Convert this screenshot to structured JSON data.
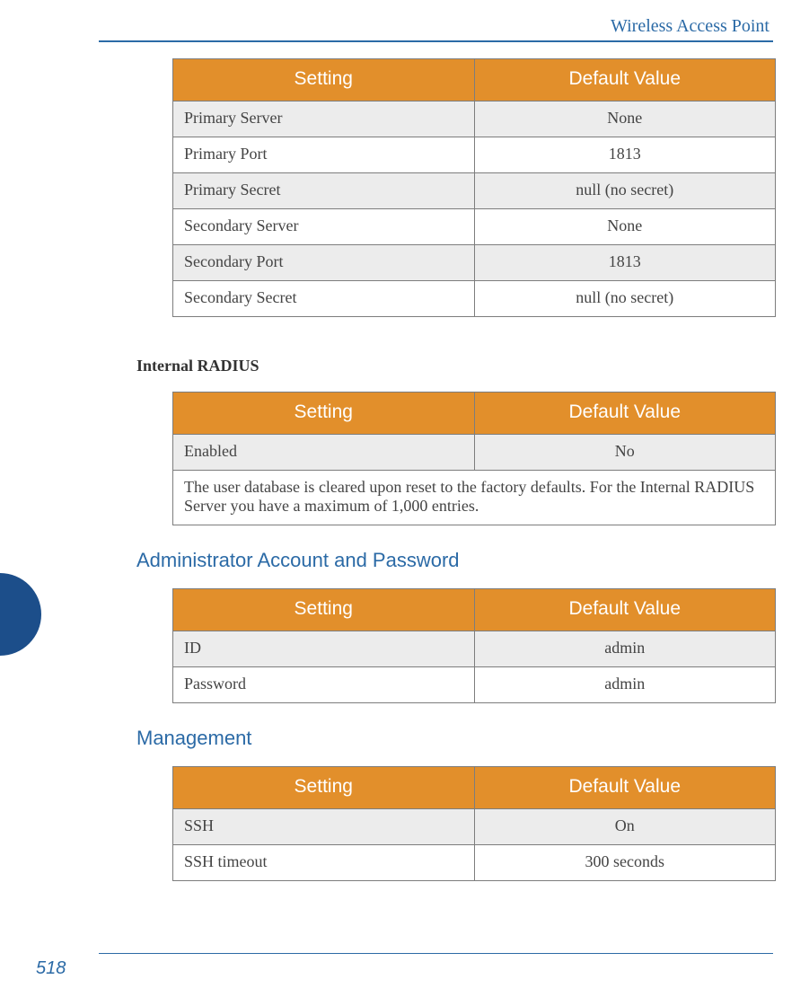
{
  "header": {
    "section_label": "Wireless Access Point"
  },
  "tables": {
    "radius_primary_secondary": {
      "columns": [
        "Setting",
        "Default Value"
      ],
      "rows": [
        {
          "setting": "Primary Server",
          "value": "None"
        },
        {
          "setting": "Primary Port",
          "value": "1813"
        },
        {
          "setting": "Primary Secret",
          "value": "null (no secret)"
        },
        {
          "setting": "Secondary Server",
          "value": "None"
        },
        {
          "setting": "Secondary Port",
          "value": "1813"
        },
        {
          "setting": "Secondary Secret",
          "value": "null (no secret)"
        }
      ]
    },
    "internal_radius": {
      "heading": "Internal RADIUS",
      "columns": [
        "Setting",
        "Default Value"
      ],
      "rows": [
        {
          "setting": "Enabled",
          "value": "No"
        }
      ],
      "note": "The user database is cleared upon reset to the factory defaults. For the Internal RADIUS Server you have a maximum of 1,000 entries."
    },
    "admin_account": {
      "heading": "Administrator Account and Password",
      "columns": [
        "Setting",
        "Default Value"
      ],
      "rows": [
        {
          "setting": "ID",
          "value": "admin"
        },
        {
          "setting": "Password",
          "value": "admin"
        }
      ]
    },
    "management": {
      "heading": "Management",
      "columns": [
        "Setting",
        "Default Value"
      ],
      "rows": [
        {
          "setting": "SSH",
          "value": "On"
        },
        {
          "setting": "SSH timeout",
          "value": "300 seconds"
        }
      ]
    }
  },
  "footer": {
    "page_number": "518"
  }
}
